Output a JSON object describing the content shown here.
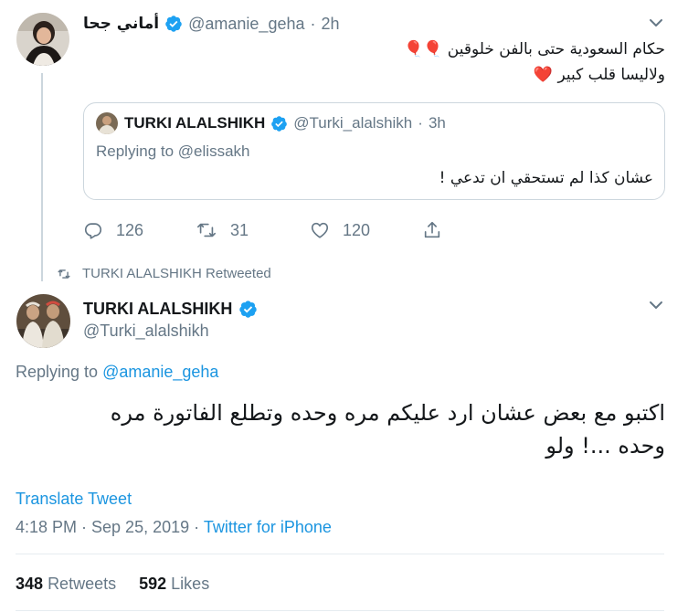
{
  "top_tweet": {
    "display_name": "أماني جحا",
    "handle": "@amanie_geha",
    "separator": "·",
    "time": "2h",
    "text_line1": "حكام السعودية حتى بالفن خلوقين 🎈🎈",
    "text_line2": "ولاليسا قلب كبير ❤️",
    "quote": {
      "display_name": "TURKI ALALSHIKH",
      "handle": "@Turki_alalshikh",
      "separator": "·",
      "time": "3h",
      "replying_prefix": "Replying to",
      "replying_to": "@elissakh",
      "text": "عشان كذا لم تستحقي ان تدعي !"
    },
    "actions": {
      "replies": "126",
      "retweets": "31",
      "likes": "120"
    }
  },
  "retweet_banner": {
    "text": "TURKI ALALSHIKH Retweeted"
  },
  "main_tweet": {
    "display_name": "TURKI ALALSHIKH",
    "handle": "@Turki_alalshikh",
    "replying_prefix": "Replying to",
    "replying_to": "@amanie_geha",
    "text_line1": "اكتبو مع بعض عشان ارد عليكم مره وحده وتطلع الفاتورة مره",
    "text_line2": "وحده ...! ولو",
    "translate": "Translate Tweet",
    "timestamp": "4:18 PM · Sep 25, 2019 ·",
    "source": "Twitter for iPhone",
    "stats": {
      "retweets_count": "348",
      "retweets_label": "Retweets",
      "likes_count": "592",
      "likes_label": "Likes"
    }
  },
  "colors": {
    "accent": "#1b95e0",
    "verified": "#1da1f2",
    "muted": "#657786",
    "border": "#ccd6dd"
  }
}
